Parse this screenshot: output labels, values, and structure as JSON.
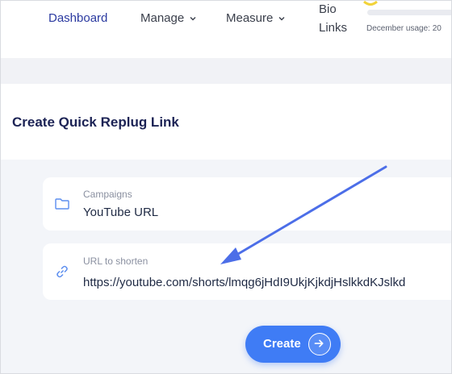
{
  "nav": {
    "dashboard": "Dashboard",
    "manage": "Manage",
    "measure": "Measure",
    "bio_links_line1": "Bio",
    "bio_links_line2": "Links",
    "usage_text": "December usage: 20"
  },
  "panel": {
    "title": "Create Quick Replug Link"
  },
  "form": {
    "campaign_label": "Campaigns",
    "campaign_value": "YouTube URL",
    "url_label": "URL to shorten",
    "url_value": "https://youtube.com/shorts/lmqg6jHdI9UkjKjkdjHslkkdKJslkd",
    "create_label": "Create"
  },
  "colors": {
    "accent": "#3f7cf5",
    "annotation_arrow": "#4c6ee8"
  }
}
